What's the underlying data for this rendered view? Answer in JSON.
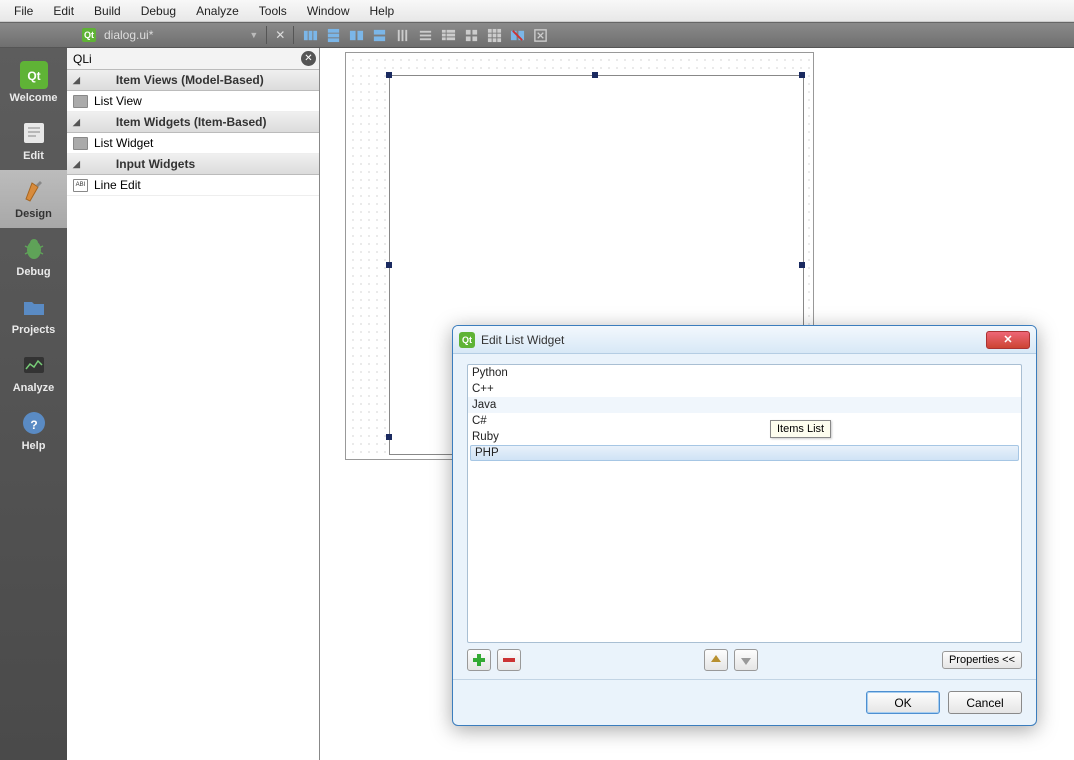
{
  "menu": {
    "file": "File",
    "edit": "Edit",
    "build": "Build",
    "debug": "Debug",
    "analyze": "Analyze",
    "tools": "Tools",
    "window": "Window",
    "help": "Help"
  },
  "toolbar": {
    "file_name": "dialog.ui*"
  },
  "modes": {
    "welcome": "Welcome",
    "edit": "Edit",
    "design": "Design",
    "debug": "Debug",
    "projects": "Projects",
    "analyze": "Analyze",
    "help": "Help"
  },
  "filter": {
    "value": "QLi"
  },
  "categories": {
    "item_views": "Item Views (Model-Based)",
    "list_view": "List View",
    "item_widgets": "Item Widgets (Item-Based)",
    "list_widget": "List Widget",
    "input_widgets": "Input Widgets",
    "line_edit": "Line Edit"
  },
  "dialog": {
    "title": "Edit List Widget",
    "items": {
      "i0": "Python",
      "i1": "C++",
      "i2": "Java",
      "i3": "C#",
      "i4": "Ruby",
      "i5": "PHP"
    },
    "tooltip": "Items List",
    "properties_btn": "Properties <<",
    "ok": "OK",
    "cancel": "Cancel"
  }
}
